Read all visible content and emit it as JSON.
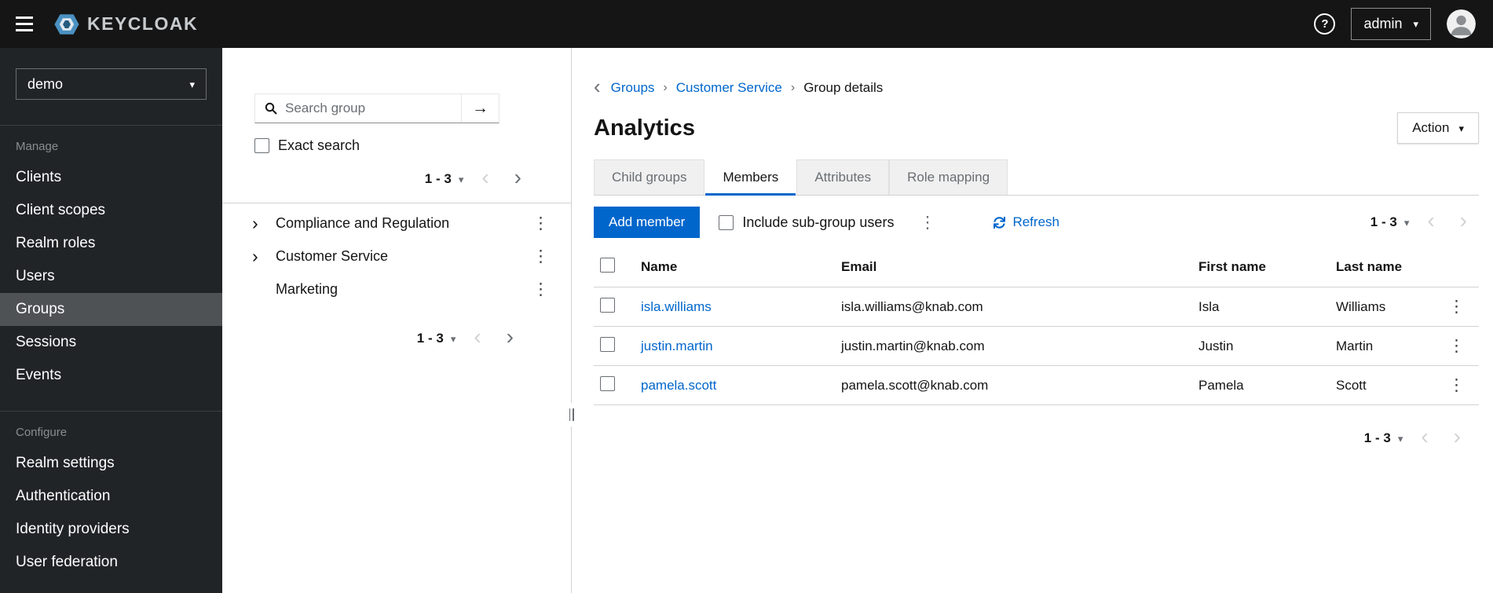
{
  "topbar": {
    "brand": "KEYCLOAK",
    "help": "?",
    "user": "admin"
  },
  "sidebar": {
    "realm": "demo",
    "sections": [
      {
        "label": "Manage",
        "items": [
          "Clients",
          "Client scopes",
          "Realm roles",
          "Users",
          "Groups",
          "Sessions",
          "Events"
        ],
        "active_item": "Groups"
      },
      {
        "label": "Configure",
        "items": [
          "Realm settings",
          "Authentication",
          "Identity providers",
          "User federation"
        ]
      }
    ]
  },
  "groups_panel": {
    "search_placeholder": "Search group",
    "exact_search_label": "Exact search",
    "pagination_top": {
      "range": "1 - 3"
    },
    "tree": [
      {
        "label": "Compliance and Regulation",
        "expandable": true
      },
      {
        "label": "Customer Service",
        "expandable": true
      },
      {
        "label": "Marketing",
        "expandable": false
      }
    ],
    "pagination_bottom": {
      "range": "1 - 3"
    }
  },
  "main": {
    "breadcrumb": [
      {
        "label": "Groups",
        "link": true
      },
      {
        "label": "Customer Service",
        "link": true
      },
      {
        "label": "Group details",
        "link": false
      }
    ],
    "title": "Analytics",
    "action_label": "Action",
    "tabs": [
      "Child groups",
      "Members",
      "Attributes",
      "Role mapping"
    ],
    "active_tab": "Members",
    "toolbar": {
      "add_member_label": "Add member",
      "include_subgroups_label": "Include sub-group users",
      "refresh_label": "Refresh",
      "pagination": {
        "range": "1 - 3"
      }
    },
    "table": {
      "headers": [
        "Name",
        "Email",
        "First name",
        "Last name"
      ],
      "rows": [
        {
          "name": "isla.williams",
          "email": "isla.williams@knab.com",
          "first": "Isla",
          "last": "Williams"
        },
        {
          "name": "justin.martin",
          "email": "justin.martin@knab.com",
          "first": "Justin",
          "last": "Martin"
        },
        {
          "name": "pamela.scott",
          "email": "pamela.scott@knab.com",
          "first": "Pamela",
          "last": "Scott"
        }
      ]
    },
    "pagination_bottom": {
      "range": "1 - 3"
    }
  },
  "icons": {
    "caret_down": "▾",
    "chevron_left": "‹",
    "chevron_right": "›",
    "kebab": "⋮",
    "breadcrumb_separator": "›",
    "back": "‹",
    "tree_expand": "›",
    "search_submit": "→"
  },
  "colors": {
    "primary": "#0066cc",
    "link": "#0066cc",
    "topbar_bg": "#151515",
    "sidebar_bg": "#212427",
    "sidebar_active_bg": "#4f5255",
    "tab_inactive_bg": "#f0f0f0",
    "border": "#d2d2d2"
  }
}
